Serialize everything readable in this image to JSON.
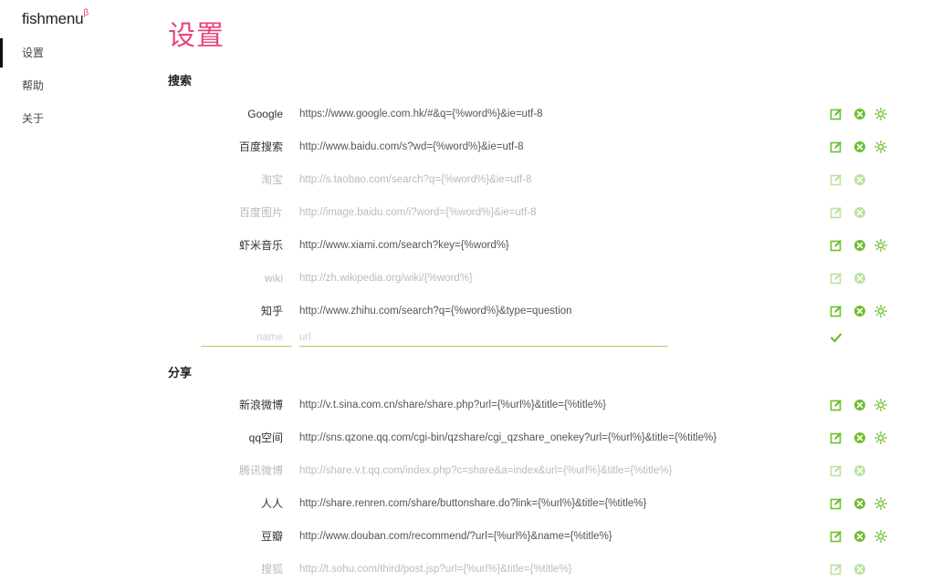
{
  "app": {
    "logo": "fishmenu",
    "logo_sup": "β"
  },
  "sidebar": {
    "items": [
      {
        "label": "设置",
        "active": true
      },
      {
        "label": "帮助",
        "active": false
      },
      {
        "label": "关于",
        "active": false
      }
    ]
  },
  "page": {
    "title": "设置"
  },
  "sections": {
    "search": {
      "title": "搜索",
      "rows": [
        {
          "name": "Google",
          "url": "https://www.google.com.hk/#&q={%word%}&ie=utf-8",
          "enabled": true
        },
        {
          "name": "百度搜索",
          "url": "http://www.baidu.com/s?wd={%word%}&ie=utf-8",
          "enabled": true
        },
        {
          "name": "淘宝",
          "url": "http://s.taobao.com/search?q={%word%}&ie=utf-8",
          "enabled": false
        },
        {
          "name": "百度图片",
          "url": "http://image.baidu.com/i?word={%word%}&ie=utf-8",
          "enabled": false
        },
        {
          "name": "虾米音乐",
          "url": "http://www.xiami.com/search?key={%word%}",
          "enabled": true
        },
        {
          "name": "wiki",
          "url": "http://zh.wikipedia.org/wiki/{%word%}",
          "enabled": false
        },
        {
          "name": "知乎",
          "url": "http://www.zhihu.com/search?q={%word%}&type=question",
          "enabled": true
        }
      ],
      "new_entry": {
        "name_placeholder": "name",
        "url_placeholder": "url"
      }
    },
    "share": {
      "title": "分享",
      "rows": [
        {
          "name": "新浪微博",
          "url": "http://v.t.sina.com.cn/share/share.php?url={%url%}&title={%title%}",
          "enabled": true
        },
        {
          "name": "qq空间",
          "url": "http://sns.qzone.qq.com/cgi-bin/qzshare/cgi_qzshare_onekey?url={%url%}&title={%title%}",
          "enabled": true
        },
        {
          "name": "腾讯微博",
          "url": "http://share.v.t.qq.com/index.php?c=share&a=index&url={%url%}&title={%title%}",
          "enabled": false
        },
        {
          "name": "人人",
          "url": "http://share.renren.com/share/buttonshare.do?link={%url%}&title={%title%}",
          "enabled": true
        },
        {
          "name": "豆瓣",
          "url": "http://www.douban.com/recommend/?url={%url%}&name={%title%}",
          "enabled": true
        },
        {
          "name": "搜狐",
          "url": "http://t.sohu.com/third/post.jsp?url={%url%}&title={%title%}",
          "enabled": false
        }
      ]
    }
  },
  "icons": {
    "edit": "edit-icon",
    "delete": "delete-icon",
    "enabled": "sun-icon",
    "disabled": "moon-icon",
    "confirm": "check-icon"
  },
  "colors": {
    "accent": "#e8447f",
    "green": "#6cbf2f",
    "disabled": "#bbbbbb"
  }
}
